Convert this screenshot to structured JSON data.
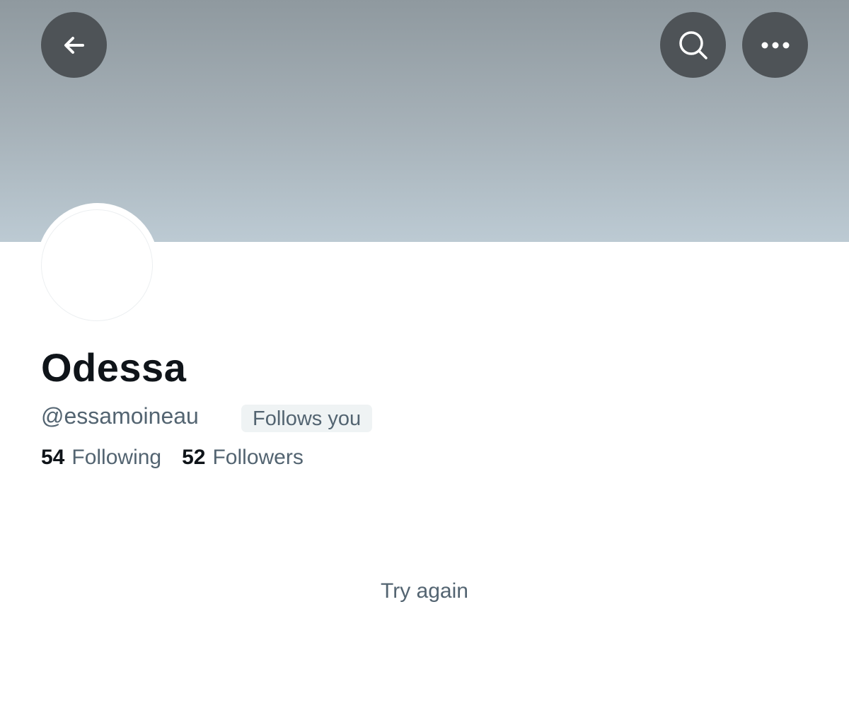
{
  "header": {
    "back_icon": "arrow-left-icon",
    "search_icon": "search-icon",
    "more_icon": "more-horizontal-icon",
    "banner_colors": [
      "#8f999f",
      "#bccad3"
    ],
    "button_bg": "#4e5357"
  },
  "profile": {
    "display_name": "Odessa",
    "handle": "@essamoineau",
    "follows_you": "Follows you",
    "following_count": "54",
    "following_label": "Following",
    "followers_count": "52",
    "followers_label": "Followers"
  },
  "content": {
    "try_again": "Try again"
  },
  "colors": {
    "primary_text": "#0f1419",
    "secondary_text": "#536471",
    "badge_bg": "#eff3f4"
  }
}
